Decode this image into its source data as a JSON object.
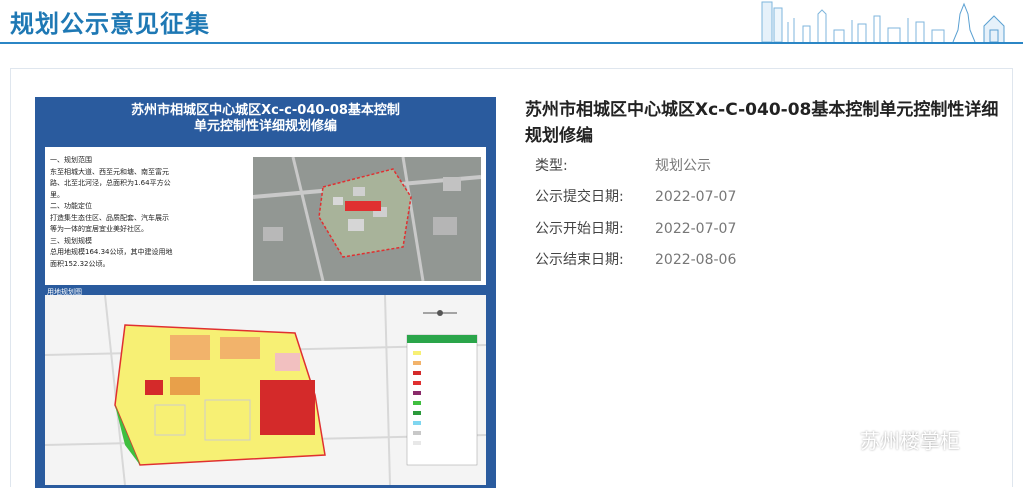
{
  "header": {
    "title": "规划公示意见征集"
  },
  "poster": {
    "title_line1": "苏州市相城区中心城区Xc-c-040-08基本控制",
    "title_line2": "单元控制性详细规划修编",
    "text_lines": [
      "一、规划范围",
      "东至相城大道、西至元和塘、南至富元",
      "路、北至北河泾，总面积为1.64平方公",
      "里。",
      "二、功能定位",
      "打造集生态住区、品质配套、汽车展示",
      "等为一体的宜居宜业美好社区。",
      "三、规划规模",
      "总用地规模164.34公顷，其中建设用地",
      "面积152.32公顷。"
    ],
    "map_label": "用地规划图"
  },
  "detail": {
    "title": "苏州市相城区中心城区Xc-C-040-08基本控制单元控制性详细规划修编",
    "rows": [
      {
        "key": "类型:",
        "value": "规划公示"
      },
      {
        "key": "公示提交日期:",
        "value": "2022-07-07"
      },
      {
        "key": "公示开始日期:",
        "value": "2022-07-07"
      },
      {
        "key": "公示结束日期:",
        "value": "2022-08-06"
      }
    ]
  },
  "watermark": {
    "text": "苏州楼掌柜",
    "icon": "wechat-icon"
  },
  "colors": {
    "accent": "#1e78b4",
    "poster_bg": "#2a5b9e"
  }
}
